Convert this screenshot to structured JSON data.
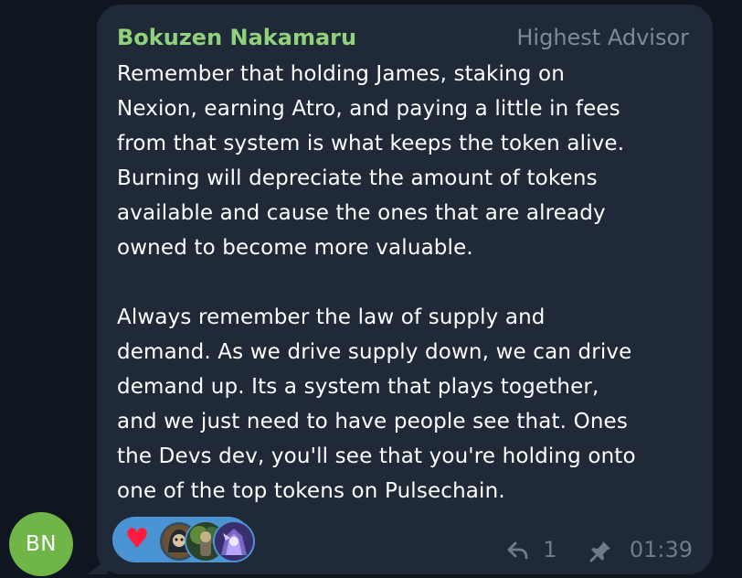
{
  "avatar": {
    "initials": "BN",
    "color": "#6fb548"
  },
  "message": {
    "sender": "Bokuzen Nakamaru",
    "role": "Highest Advisor",
    "text": "Remember that holding James, staking on\nNexion, earning Atro, and paying a little in fees\nfrom that system is what keeps the token alive.\nBurning will depreciate the amount of tokens\navailable and cause the ones that are already\nowned to become more valuable.\n\nAlways remember the law of supply and\ndemand. As we drive supply down, we can drive\ndemand up. Its a system that plays together,\nand we just need to have people see that. Ones\nthe Devs dev, you'll see that you're holding onto\none of the top tokens on Pulsechain."
  },
  "reactions": {
    "emoji_icon": "red-heart-icon",
    "background_color": "#4a94d3",
    "reactor_avatars": [
      "hooded-warrior-avatar",
      "forest-character-avatar",
      "armored-knight-avatar"
    ]
  },
  "footer": {
    "reply_icon": "reply-arrow-icon",
    "reply_count": "1",
    "pin_icon": "pin-icon",
    "time": "01:39"
  },
  "colors": {
    "background": "#0f1620",
    "bubble": "#1f2937",
    "sender_name": "#8fd27b",
    "role": "#7f8b97",
    "meta": "#6f7c88"
  }
}
